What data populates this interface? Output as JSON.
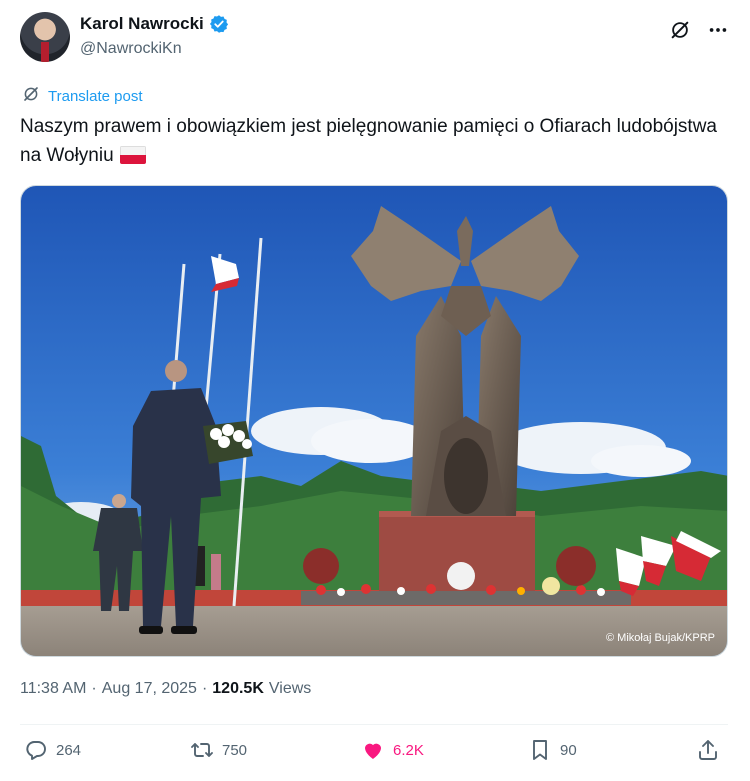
{
  "author": {
    "display_name": "Karol Nawrocki",
    "handle": "@NawrockiKn",
    "verified": true
  },
  "translate_label": "Translate post",
  "post": {
    "text": "Naszym prawem i obowiązkiem jest pielęgnowanie pamięci o Ofiarach ludobójstwa na Wołyniu",
    "emoji": "flag-poland"
  },
  "media": {
    "credit": "© Mikołaj Bujak/KPRP"
  },
  "meta": {
    "time": "11:38 AM",
    "separator": "·",
    "date": "Aug 17, 2025",
    "views_count": "120.5K",
    "views_label": "Views"
  },
  "actions": {
    "replies": "264",
    "reposts": "750",
    "likes": "6.2K",
    "bookmarks": "90"
  },
  "colors": {
    "accent": "#1d9bf0",
    "like": "#f91880",
    "secondary_text": "#536471"
  }
}
